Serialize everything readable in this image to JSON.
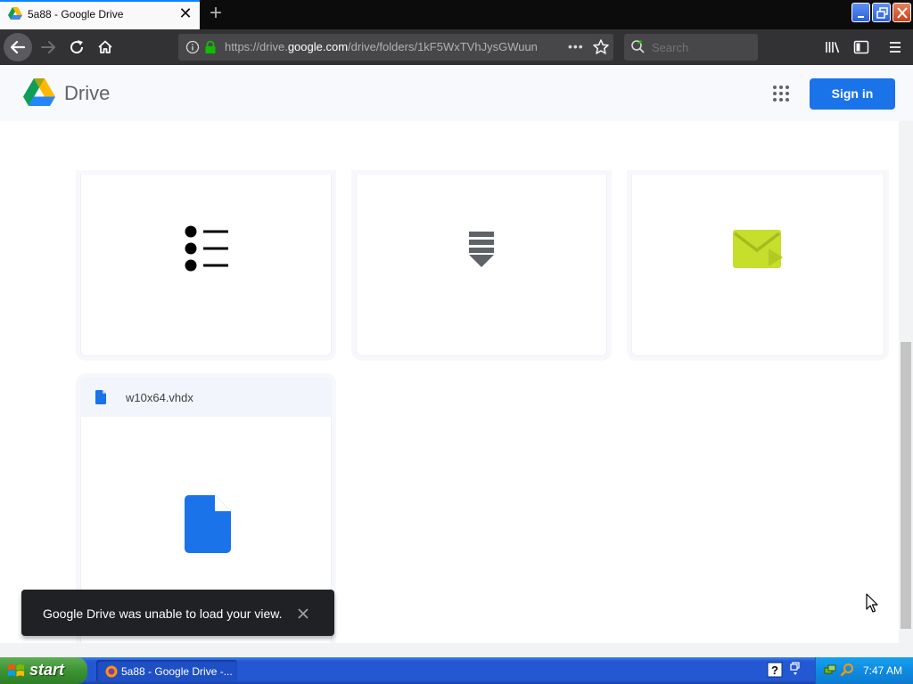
{
  "browser": {
    "tab_title": "5a88 - Google Drive",
    "url_prefix": "https://drive.",
    "url_domain": "google.com",
    "url_path": "/drive/folders/1kF5WxTVhJysGWuun",
    "search_placeholder": "Search",
    "tab_close_icon": "close-icon",
    "new_tab_label": "+"
  },
  "drive": {
    "product_name": "Drive",
    "sign_in_label": "Sign in",
    "apps_icon": "apps-grid-icon"
  },
  "files": [
    {
      "icon": "list-icon"
    },
    {
      "icon": "archive-icon"
    },
    {
      "icon": "video-mail-icon"
    },
    {
      "name": "w10x64.vhdx",
      "icon": "file-icon"
    }
  ],
  "snackbar": {
    "message": "Google Drive was unable to load your view.",
    "close_icon": "close-icon"
  },
  "taskbar": {
    "start_label": "start",
    "task_label": "5a88 - Google Drive -...",
    "clock": "7:47 AM"
  },
  "colors": {
    "accent": "#1a73e8",
    "mail_icon": "#c6de2c"
  }
}
